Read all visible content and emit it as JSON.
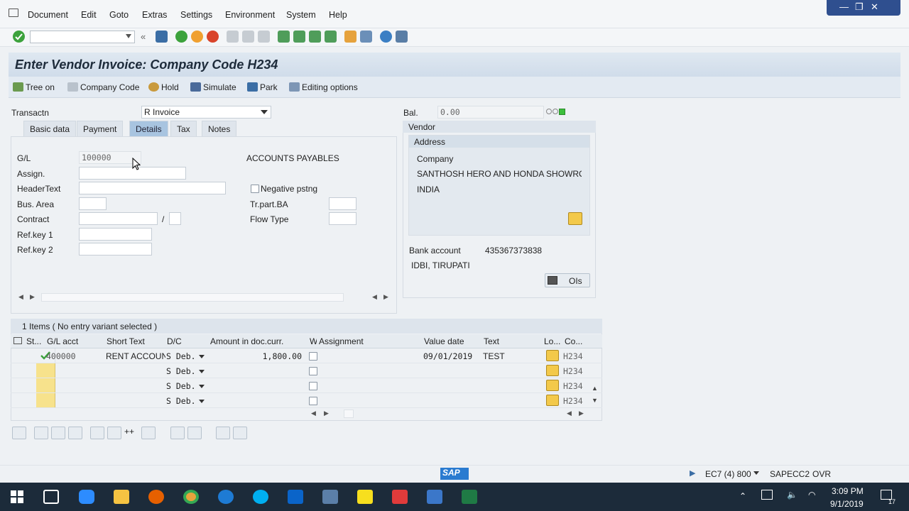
{
  "menu": {
    "items": [
      "Document",
      "Edit",
      "Goto",
      "Extras",
      "Settings",
      "Environment",
      "System",
      "Help"
    ]
  },
  "window_controls": [
    "—",
    "❐",
    "✕"
  ],
  "title": "Enter Vendor Invoice: Company Code H234",
  "app_toolbar": {
    "tree_on": "Tree on",
    "company_code": "Company Code",
    "hold": "Hold",
    "simulate": "Simulate",
    "park": "Park",
    "editing_options": "Editing options"
  },
  "header": {
    "transaction_label": "Transactn",
    "transaction_value": "R Invoice",
    "balance_label": "Bal.",
    "balance_value": "0.00"
  },
  "tabs": [
    "Basic data",
    "Payment",
    "Details",
    "Tax",
    "Notes"
  ],
  "active_tab": "Details",
  "details": {
    "gl_label": "G/L",
    "gl_value": "100000",
    "gl_text": "ACCOUNTS PAYABLES",
    "assign_label": "Assign.",
    "header_text_label": "HeaderText",
    "negative_pstng_label": "Negative pstng",
    "bus_area_label": "Bus. Area",
    "tr_part_ba_label": "Tr.part.BA",
    "contract_label": "Contract",
    "contract_sep": "/",
    "flow_type_label": "Flow Type",
    "ref_key1_label": "Ref.key 1",
    "ref_key2_label": "Ref.key 2"
  },
  "vendor": {
    "title": "Vendor",
    "address_title": "Address",
    "company_label": "Company",
    "name": "SANTHOSH HERO AND HONDA SHOWROO",
    "country": "INDIA",
    "bank_account_label": "Bank account",
    "bank_account_value": "435367373838",
    "bank_name": "IDBI, TIRUPATI",
    "ois_label": "OIs"
  },
  "items": {
    "caption": "1 Items ( No entry variant selected )",
    "columns": [
      "St...",
      "G/L acct",
      "Short Text",
      "D/C",
      "Amount in doc.curr.",
      "W",
      "Assignment",
      "Value date",
      "Text",
      "Lo...",
      "Co..."
    ],
    "rows": [
      {
        "gl": "400000",
        "short_text": "RENT ACCOUN",
        "dc": "S Deb.",
        "amount": "1,800.00",
        "value_date": "09/01/2019",
        "text": "TEST",
        "co": "H234"
      },
      {
        "gl": "",
        "short_text": "",
        "dc": "S Deb.",
        "amount": "",
        "value_date": "",
        "text": "",
        "co": "H234"
      },
      {
        "gl": "",
        "short_text": "",
        "dc": "S Deb.",
        "amount": "",
        "value_date": "",
        "text": "",
        "co": "H234"
      },
      {
        "gl": "",
        "short_text": "",
        "dc": "S Deb.",
        "amount": "",
        "value_date": "",
        "text": "",
        "co": "H234"
      }
    ]
  },
  "status": {
    "logo": "SAP",
    "system": "EC7 (4) 800",
    "server": "SAPECC2",
    "mode": "OVR"
  },
  "taskbar": {
    "time": "3:09 PM",
    "date": "9/1/2019",
    "notifications": "17"
  }
}
